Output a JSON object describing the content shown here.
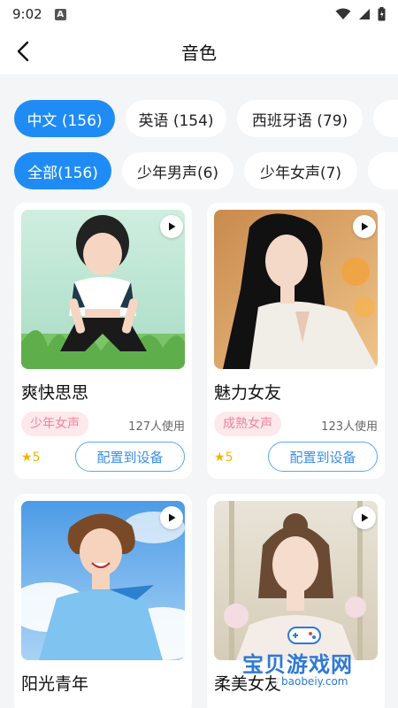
{
  "status_bar": {
    "time": "9:02",
    "notification_badge": "A"
  },
  "header": {
    "title": "音色"
  },
  "language_filters": [
    {
      "label": "中文 (156)",
      "active": true
    },
    {
      "label": "英语 (154)",
      "active": false
    },
    {
      "label": "西班牙语 (79)",
      "active": false
    }
  ],
  "category_filters": [
    {
      "label": "全部(156)",
      "active": true
    },
    {
      "label": "少年男声(6)",
      "active": false
    },
    {
      "label": "少年女声(7)",
      "active": false
    }
  ],
  "voices": [
    {
      "name": "爽快思思",
      "tag": "少年女声",
      "usage": "127人使用",
      "rating": "5",
      "button": "配置到设备"
    },
    {
      "name": "魅力女友",
      "tag": "成熟女声",
      "usage": "123人使用",
      "rating": "5",
      "button": "配置到设备"
    },
    {
      "name": "阳光青年"
    },
    {
      "name": "柔美女友"
    }
  ],
  "watermark": {
    "text": "宝贝游戏网",
    "url": "baobeiy.com"
  },
  "colors": {
    "accent": "#1f8cf5",
    "tag_bg": "#fde8ec",
    "tag_text": "#f0849b",
    "star": "#f0b400"
  }
}
